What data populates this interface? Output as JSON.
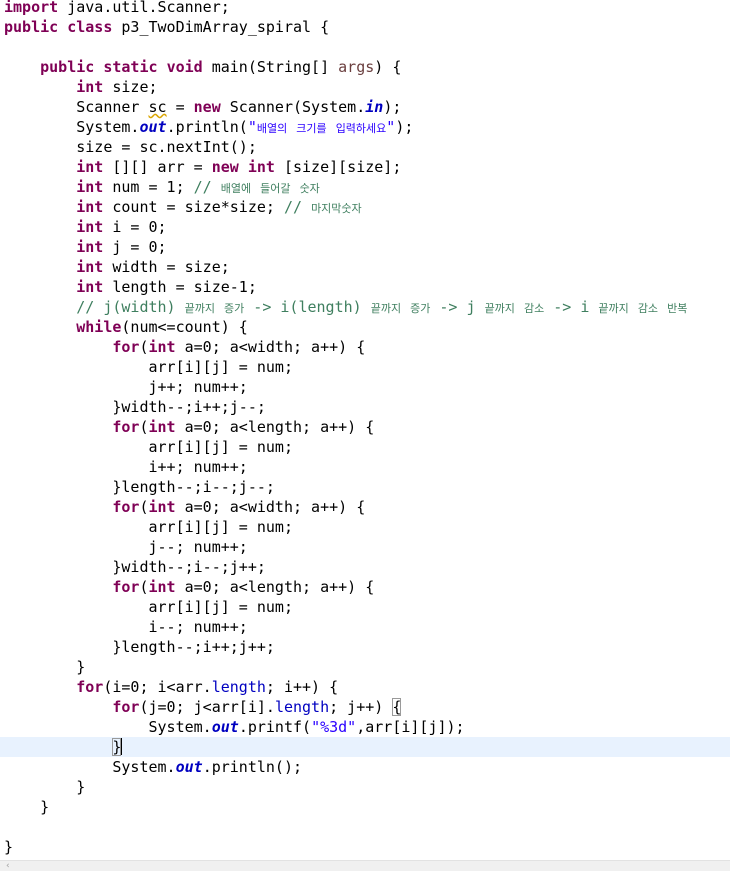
{
  "editor": {
    "lines": [
      "import java.util.Scanner;",
      "public class p3_TwoDimArray_spiral {",
      "",
      "    public static void main(String[] args) {",
      "        int size;",
      "        Scanner sc = new Scanner(System.in);",
      "        System.out.println(\"배열의 크기를 입력하세요\");",
      "        size = sc.nextInt();",
      "        int [][] arr = new int [size][size];",
      "        int num = 1; // 배열에 들어갈 숫자",
      "        int count = size*size; // 마지막숫자",
      "        int i = 0;",
      "        int j = 0;",
      "        int width = size;",
      "        int length = size-1;",
      "        // j(width) 끝까지 증가 -> i(length) 끝까지 증가 -> j 끝까지 감소 -> i 끝까지 감소 반복",
      "        while(num<=count) {",
      "            for(int a=0; a<width; a++) {",
      "                arr[i][j] = num;",
      "                j++; num++;",
      "            }width--;i++;j--;",
      "            for(int a=0; a<length; a++) {",
      "                arr[i][j] = num;",
      "                i++; num++;",
      "            }length--;i--;j--;",
      "            for(int a=0; a<width; a++) {",
      "                arr[i][j] = num;",
      "                j--; num++;",
      "            }width--;i--;j++;",
      "            for(int a=0; a<length; a++) {",
      "                arr[i][j] = num;",
      "                i--; num++;",
      "            }length--;i++;j++;",
      "        }",
      "        for(i=0; i<arr.length; i++) {",
      "            for(j=0; j<arr[i].length; j++) {",
      "                System.out.printf(\"%3d\",arr[i][j]);",
      "            }",
      "            System.out.println();",
      "        }",
      "    }",
      "",
      "}"
    ],
    "current_line_index": 37,
    "colors": {
      "keyword": "#7f0055",
      "string": "#2a00ff",
      "comment": "#3f7f5f",
      "static_field": "#0000c0",
      "current_line_bg": "#e8f2fe"
    }
  },
  "scrollbar": {
    "left_arrow_icon": "chevron-left-icon",
    "left_arrow_glyph": "‹"
  }
}
